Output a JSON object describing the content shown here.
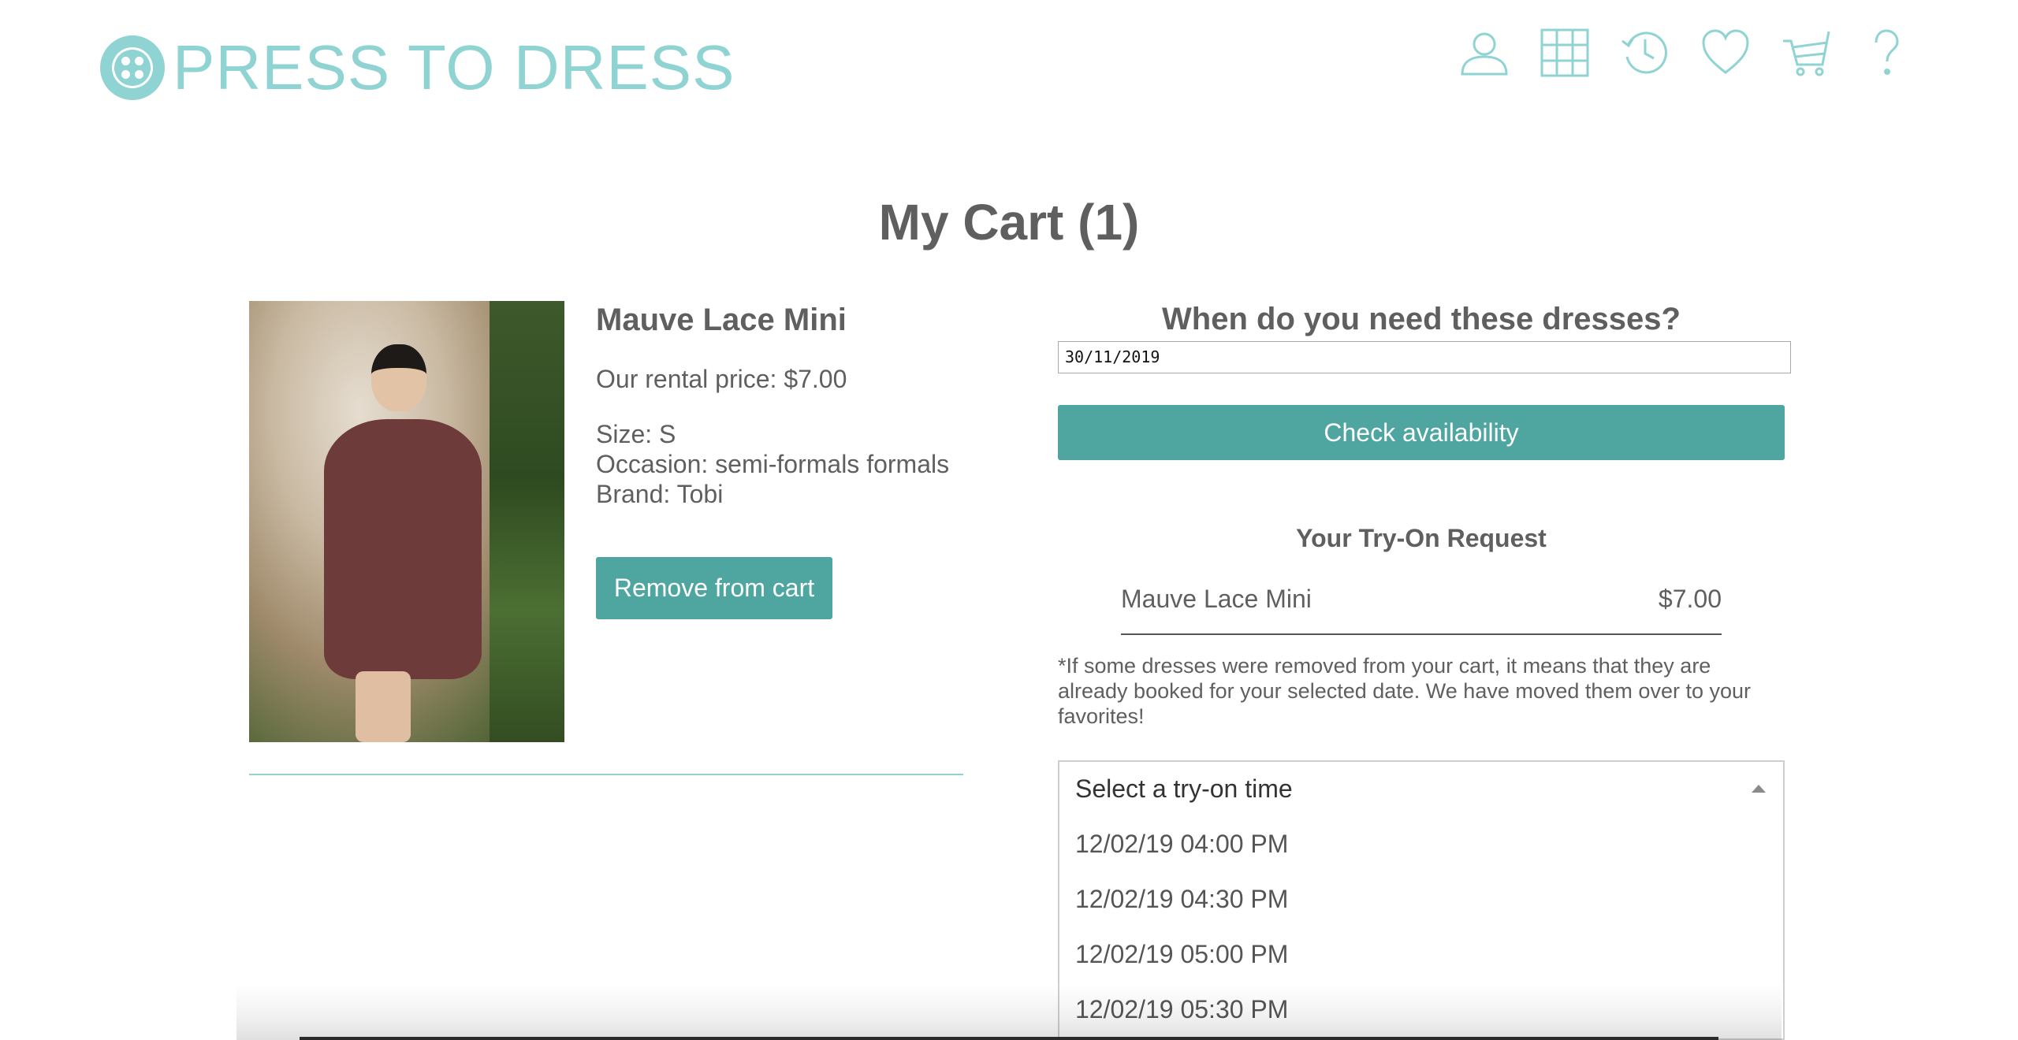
{
  "brand": {
    "name": "PRESS TO DRESS",
    "color": "#8fd3d3"
  },
  "nav": {
    "icons": [
      "user-icon",
      "grid-icon",
      "history-icon",
      "heart-icon",
      "cart-icon",
      "help-icon"
    ]
  },
  "page": {
    "title": "My Cart (1)"
  },
  "product": {
    "name": "Mauve Lace Mini",
    "price": "Our rental price: $7.00",
    "size": "Size: S",
    "occasion": "Occasion: semi-formals formals",
    "brand": "Brand: Tobi",
    "remove_label": "Remove from cart"
  },
  "booking": {
    "question": "When do you need these dresses?",
    "date_value": "30/11/2019",
    "check_label": "Check availability",
    "accent": "#4fa6a1"
  },
  "tryon": {
    "title": "Your Try-On Request",
    "items": [
      {
        "name": "Mauve Lace Mini",
        "price": "$7.00"
      }
    ],
    "disclaimer": "*If some dresses were removed from your cart, it means that they are already booked for your selected date. We have moved them over to your favorites!",
    "select_placeholder": "Select a try-on time",
    "options": [
      "12/02/19 04:00 PM",
      "12/02/19 04:30 PM",
      "12/02/19 05:00 PM",
      "12/02/19 05:30 PM"
    ]
  }
}
